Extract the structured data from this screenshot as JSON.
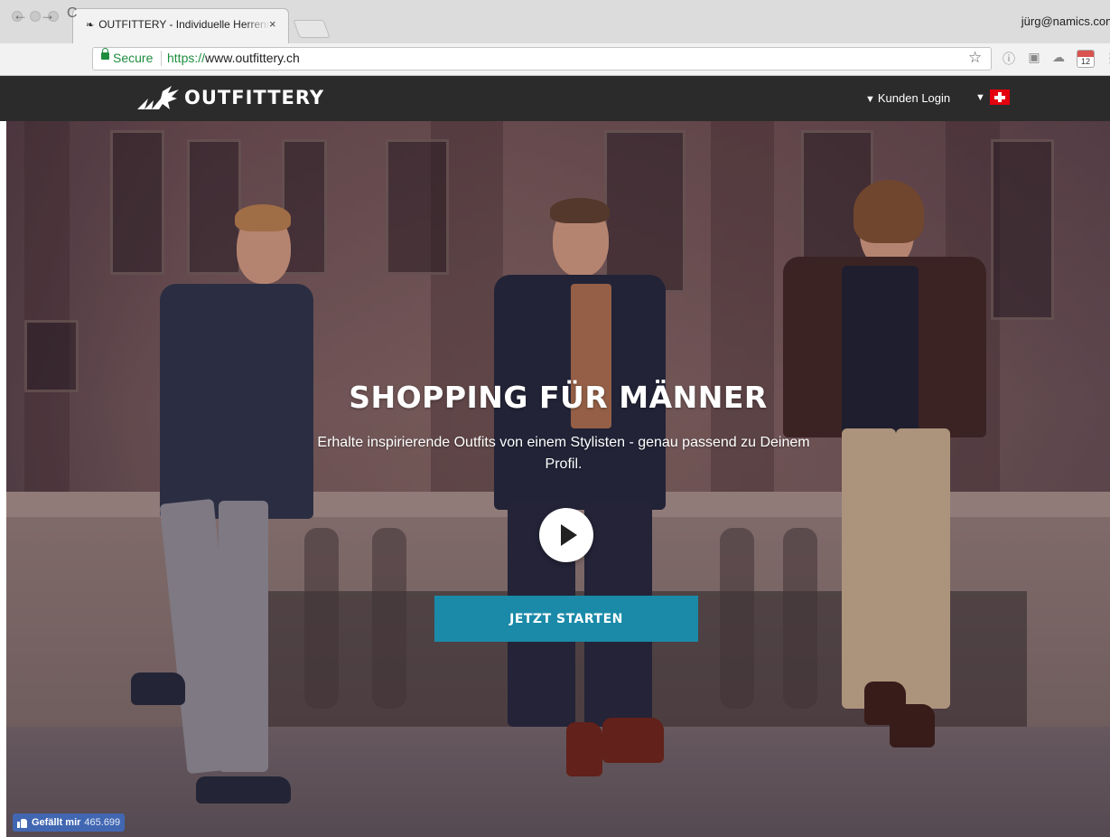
{
  "browser": {
    "tab_title": "OUTFITTERY - Individuelle Herrenmode",
    "tab_close": "×",
    "profile": "jürg@namics.com",
    "secure_label": "Secure",
    "url_scheme": "https://",
    "url_host": "www.outfittery.ch",
    "nav": {
      "back": "←",
      "forward": "→",
      "reload": "C"
    },
    "star": "☆",
    "extensions": [
      "info-icon",
      "screen-icon",
      "cloud-icon"
    ],
    "calendar_day": "12",
    "more": "⋮"
  },
  "site": {
    "brand": "OUTFITTERY",
    "login_arrow": "▼",
    "login_label": "Kunden Login",
    "country_arrow": "▼",
    "country_flag": "swiss-flag-icon"
  },
  "hero": {
    "title": "SHOPPING FÜR MÄNNER",
    "subtitle": "Erhalte inspirierende Outfits von einem Stylisten - genau passend zu Deinem Profil.",
    "cta_label": "JETZT STARTEN",
    "accent": "#1a8aa8"
  },
  "facebook": {
    "label": "Gefällt mir",
    "count": "465.699",
    "color": "#4267b2"
  }
}
